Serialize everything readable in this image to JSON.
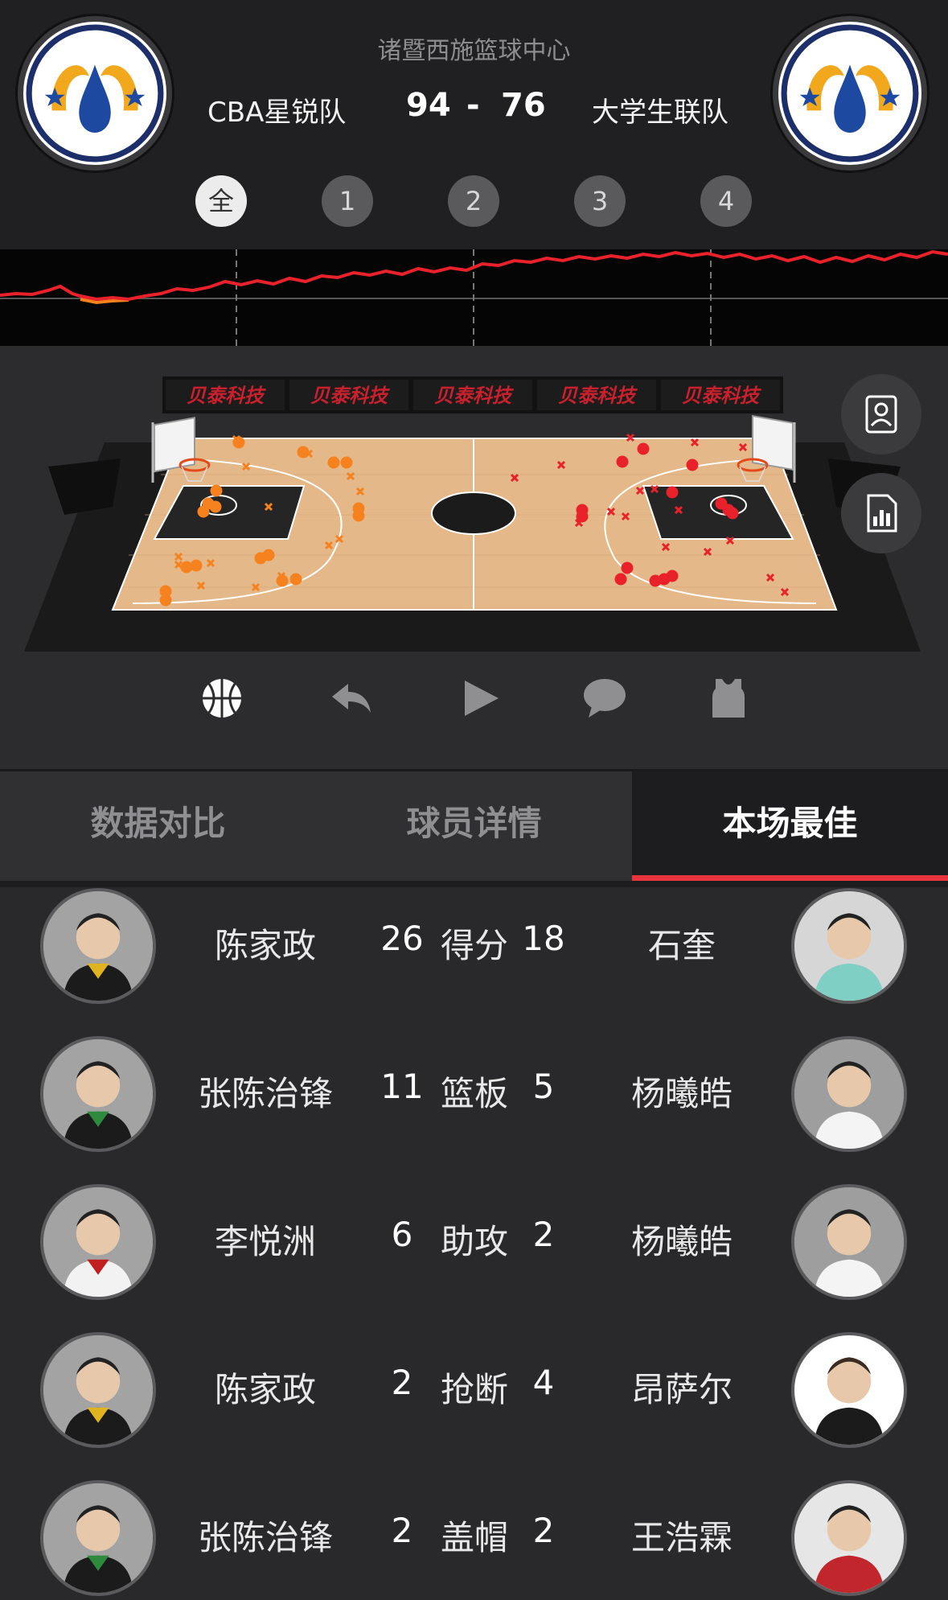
{
  "match": {
    "venue": "诸暨西施篮球中心",
    "home_team": "CBA星锐队",
    "away_team": "大学生联队",
    "home_score": "94",
    "separator": "-",
    "away_score": "76"
  },
  "periods": [
    {
      "label": "全",
      "active": true
    },
    {
      "label": "1",
      "active": false
    },
    {
      "label": "2",
      "active": false
    },
    {
      "label": "3",
      "active": false
    },
    {
      "label": "4",
      "active": false
    }
  ],
  "court": {
    "sponsor": "贝泰科技",
    "home_color": "#f5821f",
    "away_color": "#e8212a"
  },
  "icons": {
    "side": [
      "player-card-icon",
      "stats-chart-icon"
    ],
    "toolbar": [
      "basketball-icon",
      "replay-icon",
      "play-icon",
      "comment-icon",
      "jersey-icon"
    ]
  },
  "tabs": [
    {
      "label": "数据对比",
      "active": false
    },
    {
      "label": "球员详情",
      "active": false
    },
    {
      "label": "本场最佳",
      "active": true
    }
  ],
  "best": [
    {
      "stat": "得分",
      "home_player": "陈家政",
      "home_value": "26",
      "away_value": "18",
      "away_player": "石奎"
    },
    {
      "stat": "篮板",
      "home_player": "张陈治锋",
      "home_value": "11",
      "away_value": "5",
      "away_player": "杨曦皓"
    },
    {
      "stat": "助攻",
      "home_player": "李悦洲",
      "home_value": "6",
      "away_value": "2",
      "away_player": "杨曦皓"
    },
    {
      "stat": "抢断",
      "home_player": "陈家政",
      "home_value": "2",
      "away_value": "4",
      "away_player": "昂萨尔"
    },
    {
      "stat": "盖帽",
      "home_player": "张陈治锋",
      "home_value": "2",
      "away_value": "2",
      "away_player": "王浩霖"
    }
  ],
  "colors": {
    "accent": "#e8353b",
    "trend_line": "#e8212a",
    "trend_negative": "#f5821f"
  }
}
